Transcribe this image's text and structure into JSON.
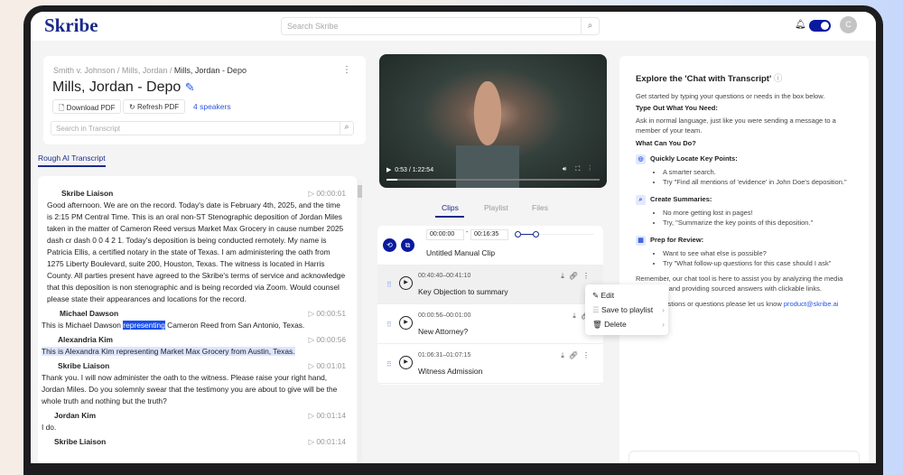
{
  "header": {
    "logo": "Skribe",
    "search_placeholder": "Search Skribe",
    "avatar_initial": "C"
  },
  "doc": {
    "breadcrumb": [
      "Smith v. Johnson",
      "Mills, Jordan",
      "Mills, Jordan - Depo"
    ],
    "title": "Mills, Jordan - Depo",
    "download_pdf": "Download PDF",
    "refresh_pdf": "Refresh PDF",
    "speakers": "4 speakers",
    "search_placeholder": "Search in Transcript",
    "tab": "Rough AI Transcript"
  },
  "transcript": [
    {
      "speaker": "Skribe Liaison",
      "time": "00:00:01",
      "text": "Good afternoon. We are on the record. Today's date is February 4th, 2025, and the time is 2:15 PM Central Time. This is an oral non-ST Stenographic deposition of Jordan Miles taken in the matter of Cameron Reed versus Market Max Grocery in cause number 2025 dash cr dash 0 0 4 2 1. Today's deposition is being conducted remotely. My name is Patricia Ellis, a certified notary in the state of Texas. I am administering the oath from 1275 Liberty Boulevard, suite 200, Houston, Texas. The witness is located in Harris County. All parties present have agreed to the Skribe's terms of service and acknowledge that this deposition is non stenographic and is being recorded via Zoom. Would counsel please state their appearances and locations for the record."
    },
    {
      "speaker": "Michael Dawson",
      "time": "00:00:51",
      "text_pre": "This is Michael Dawson ",
      "text_hl": "representing",
      "text_post": " Cameron Reed from San Antonio, Texas."
    },
    {
      "speaker": "Alexandria Kim",
      "time": "00:00:56",
      "text": "This is Alexandra Kim representing Market Max Grocery from Austin, Texas."
    },
    {
      "speaker": "Skribe Liaison",
      "time": "00:01:01",
      "text": "Thank you. I will now administer the oath to the witness. Please raise your right hand, Jordan Miles. Do you solemnly swear that the testimony you are about to give will be the whole truth and nothing but the truth?"
    },
    {
      "speaker": "Jordan Kim",
      "time": "00:01:14",
      "text": "I do."
    },
    {
      "speaker": "Skribe Liaison",
      "time": "00:01:14",
      "text": ""
    }
  ],
  "video": {
    "time": "0:53 / 1:22:54",
    "progress": 0.011
  },
  "media_tabs": [
    "Clips",
    "Playlist",
    "Files"
  ],
  "manual_clip": {
    "start": "00:00:00",
    "end": "00:16:35",
    "name": "Untitled Manual Clip"
  },
  "clips": [
    {
      "time": "00:40:40–00:41:10",
      "name": "Key Objection to summary"
    },
    {
      "time": "00:00:56–00:01:00",
      "name": "New Attorney?"
    },
    {
      "time": "01:06:31–01:07:15",
      "name": "Witness Admission"
    }
  ],
  "context_menu": [
    "Edit",
    "Save to playlist",
    "Delete"
  ],
  "chat": {
    "title": "Explore the 'Chat with Transcript'",
    "intro": "Get started by typing your questions or needs in the box below.",
    "h1": "Type Out What You Need:",
    "p1": "Ask in normal language, just like you were sending a message to a member of your team.",
    "h2": "What Can You Do?",
    "sections": [
      {
        "title": "Quickly Locate Key Points:",
        "bullets": [
          "A smarter search.",
          "Try \"Find all mentions of 'evidence' in John Doe's deposition.\""
        ]
      },
      {
        "title": "Create Summaries:",
        "bullets": [
          "No more getting lost in pages!",
          "Try, \"Summarize the key points of this deposition.\""
        ]
      },
      {
        "title": "Prep for Review:",
        "bullets": [
          "Want to see what else is possible?",
          "Try \"What follow-up questions for this case should I ask\""
        ]
      }
    ],
    "p2": "Remember, our chat tool is here to assist you by analyzing the media transcripts and providing sourced answers with clickable links.",
    "p3": "Any suggestions or questions please let us know ",
    "email": "product@skribe.ai"
  },
  "colors": {
    "brand": "#1b2a8a",
    "accent": "#2a55e0",
    "toggle": "#0a1a9e"
  }
}
